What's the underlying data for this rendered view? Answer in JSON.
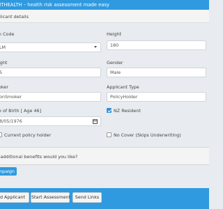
{
  "header": {
    "title": "RTHEALTH – health risk assessment made easy"
  },
  "section": {
    "title": "plicant details"
  },
  "form": {
    "plan_code": {
      "label": "n Code",
      "value": "LM"
    },
    "height": {
      "label": "Height",
      "value": "180"
    },
    "weight": {
      "label": "ight",
      "value": "5"
    },
    "gender": {
      "label": "Gender",
      "value": "Male"
    },
    "smoker": {
      "label": "oker",
      "value": "onSmoker"
    },
    "applicant_type": {
      "label": "Applicant Type",
      "value": "PolicyHolder"
    },
    "dob": {
      "label": "e of Birth [ Age 46]",
      "value": "8/05/1976"
    },
    "nz_resident": {
      "label": "NZ Resident",
      "checked": true
    },
    "current_policy_holder": {
      "label": "Current policy holder",
      "checked": false
    },
    "no_cover": {
      "label": "No Cover (Skips Underwriting)",
      "checked": false
    }
  },
  "benefits": {
    "question": "t additional benefits would you like?"
  },
  "buttons": {
    "campaign": "mpaign",
    "add_applicant": "d Applicant",
    "start_assessment": "Start Assessment",
    "send_links": "Send Links"
  },
  "colors": {
    "primary": "#2f9ae0",
    "checkbox_on": "#2f8fd8"
  }
}
